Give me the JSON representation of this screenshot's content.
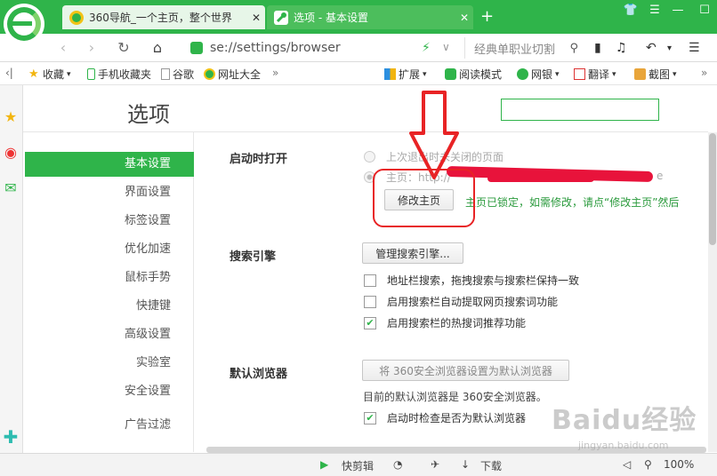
{
  "tabs": [
    {
      "label": "360导航_一个主页，整个世界",
      "icon": "360-nav-icon"
    },
    {
      "label": "选项 - 基本设置",
      "icon": "wrench-icon"
    }
  ],
  "address": {
    "url": "se://settings/browser",
    "search_placeholder": "经典单职业切割"
  },
  "bookmarks": [
    {
      "label": "收藏",
      "icon": "star-icon"
    },
    {
      "label": "手机收藏夹",
      "icon": "phone-icon"
    },
    {
      "label": "谷歌",
      "icon": "page-icon"
    },
    {
      "label": "网址大全",
      "icon": "360-nav-icon"
    },
    {
      "label": "»"
    },
    {
      "label": "扩展",
      "icon": "extension-icon"
    },
    {
      "label": "阅读模式",
      "icon": "read-icon"
    },
    {
      "label": "网银",
      "icon": "bank-icon"
    },
    {
      "label": "翻译",
      "icon": "translate-icon"
    },
    {
      "label": "截图",
      "icon": "screenshot-icon"
    }
  ],
  "page": {
    "title": "选项"
  },
  "sidebar": {
    "items": [
      {
        "label": "基本设置"
      },
      {
        "label": "界面设置"
      },
      {
        "label": "标签设置"
      },
      {
        "label": "优化加速"
      },
      {
        "label": "鼠标手势"
      },
      {
        "label": "快捷键"
      },
      {
        "label": "高级设置"
      },
      {
        "label": "实验室"
      },
      {
        "label": "安全设置"
      },
      {
        "label": "广告过滤"
      }
    ]
  },
  "startup": {
    "label": "启动时打开",
    "option1": "上次退出时未关闭的页面",
    "option2": "主页：http://",
    "option2_tail": "e",
    "button": "修改主页",
    "note": "主页已锁定，如需修改，请点“修改主页”然后"
  },
  "search_engine": {
    "label": "搜索引擎",
    "button": "管理搜索引擎...",
    "checks": [
      {
        "label": "地址栏搜索，拖拽搜索与搜索栏保持一致",
        "checked": false
      },
      {
        "label": "启用搜索栏自动提取网页搜索词功能",
        "checked": false
      },
      {
        "label": "启用搜索栏的热搜词推荐功能",
        "checked": true
      }
    ]
  },
  "default_browser": {
    "label": "默认浏览器",
    "button": "将 360安全浏览器设置为默认浏览器",
    "status": "目前的默认浏览器是 360安全浏览器。",
    "check": "启动时检查是否为默认浏览器"
  },
  "statusbar": {
    "clip": "快剪辑",
    "download": "下载",
    "zoom": "100%"
  },
  "watermark": {
    "logo": "Baidu经验",
    "site": "jingyan.baidu.com"
  },
  "colors": {
    "accent": "#2fb44a",
    "annotation": "#e82325"
  }
}
